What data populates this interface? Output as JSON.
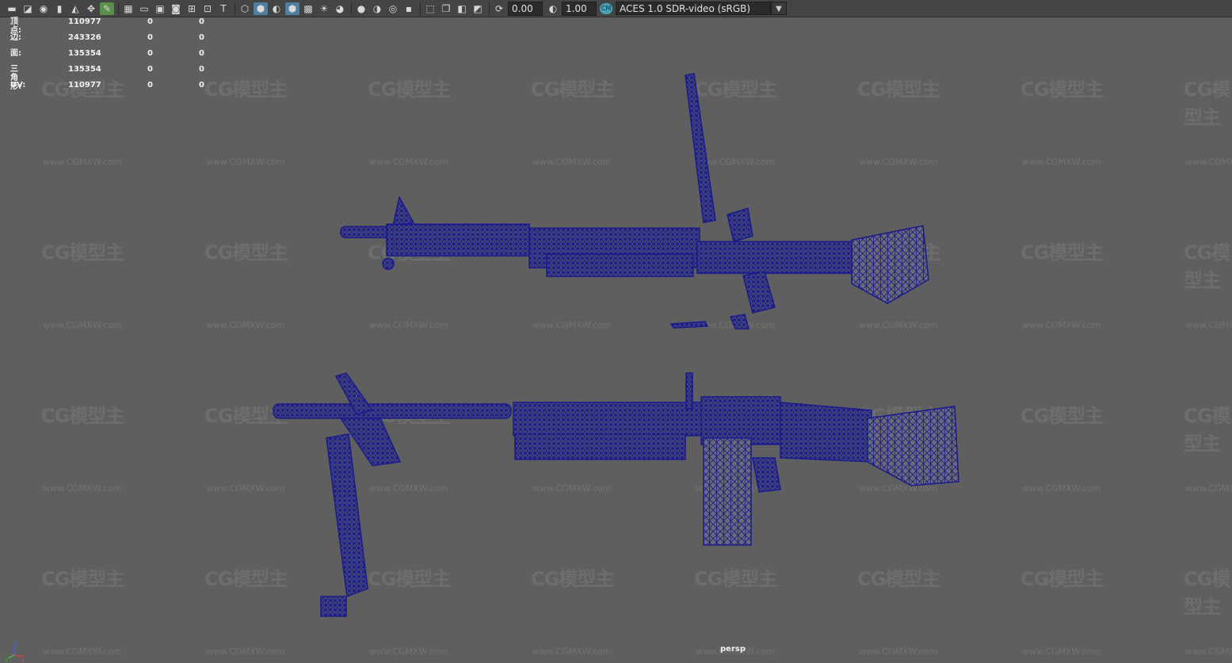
{
  "toolbar": {
    "icons": [
      "camera-icon",
      "camera-attributes-icon",
      "bookmark-icon",
      "image-plane-icon",
      "grid-icon",
      "film-gate-icon",
      "resolution-gate-icon",
      "gate-mask-icon",
      "field-chart-icon",
      "safe-action-icon",
      "safe-title-icon",
      "wireframe-icon",
      "smooth-shade-icon",
      "flat-shade-icon",
      "textured-icon",
      "lights-icon",
      "shadows-icon",
      "ambient-occlusion-icon",
      "motion-blur-icon",
      "anti-alias-icon",
      "isolate-icon",
      "xray-icon",
      "xray-joints-icon",
      "backface-icon",
      "exposure-icon",
      "gamma-icon"
    ],
    "exposure_value": "0.00",
    "gamma_value": "1.00",
    "color_badge": "CM",
    "color_space": "ACES 1.0 SDR-video (sRGB)"
  },
  "hud": {
    "rows": [
      {
        "label": "顶点:",
        "value": "110977",
        "c2": "0",
        "c3": "0"
      },
      {
        "label": "边:",
        "value": "243326",
        "c2": "0",
        "c3": "0"
      },
      {
        "label": "面:",
        "value": "135354",
        "c2": "0",
        "c3": "0"
      },
      {
        "label": "三角形:",
        "value": "135354",
        "c2": "0",
        "c3": "0"
      },
      {
        "label": "UV:",
        "value": "110977",
        "c2": "0",
        "c3": "0"
      }
    ]
  },
  "viewport": {
    "camera": "persp",
    "watermark": "CG模型主",
    "watermark_url": "www.CGMXW.com",
    "wire_color": "#1a1a8c"
  },
  "axis": {
    "x": "x",
    "y": "y",
    "z": "z"
  }
}
